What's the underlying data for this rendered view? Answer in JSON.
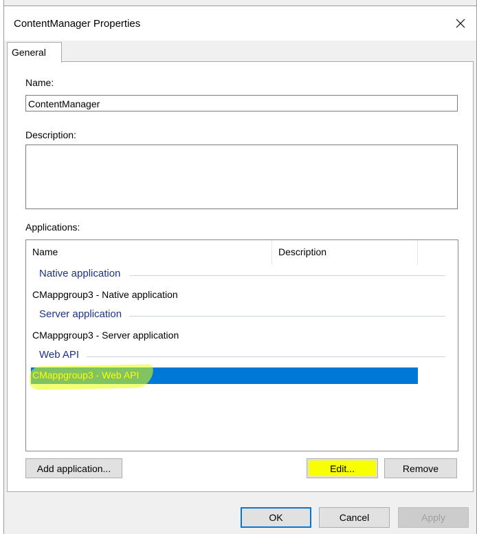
{
  "window": {
    "title": "ContentManager Properties"
  },
  "tabs": [
    {
      "label": "General",
      "selected": true
    }
  ],
  "form": {
    "name_label": "Name:",
    "name_value": "ContentManager",
    "description_label": "Description:",
    "description_value": "",
    "applications_label": "Applications:"
  },
  "applications": {
    "columns": [
      "Name",
      "Description"
    ],
    "groups": [
      {
        "title": "Native application",
        "items": [
          "CMappgroup3 - Native application"
        ]
      },
      {
        "title": "Server application",
        "items": [
          "CMappgroup3 - Server application"
        ]
      },
      {
        "title": "Web API",
        "items": [
          "CMappgroup3 - Web API"
        ]
      }
    ],
    "selected_item": "CMappgroup3 - Web API"
  },
  "buttons": {
    "add_application": "Add application...",
    "edit": "Edit...",
    "remove": "Remove",
    "ok": "OK",
    "cancel": "Cancel",
    "apply": "Apply"
  },
  "colors": {
    "selection": "#0078d7",
    "group_text": "#1e3287",
    "highlight": "#f7ff00"
  },
  "icons": {
    "close": "close-icon"
  }
}
